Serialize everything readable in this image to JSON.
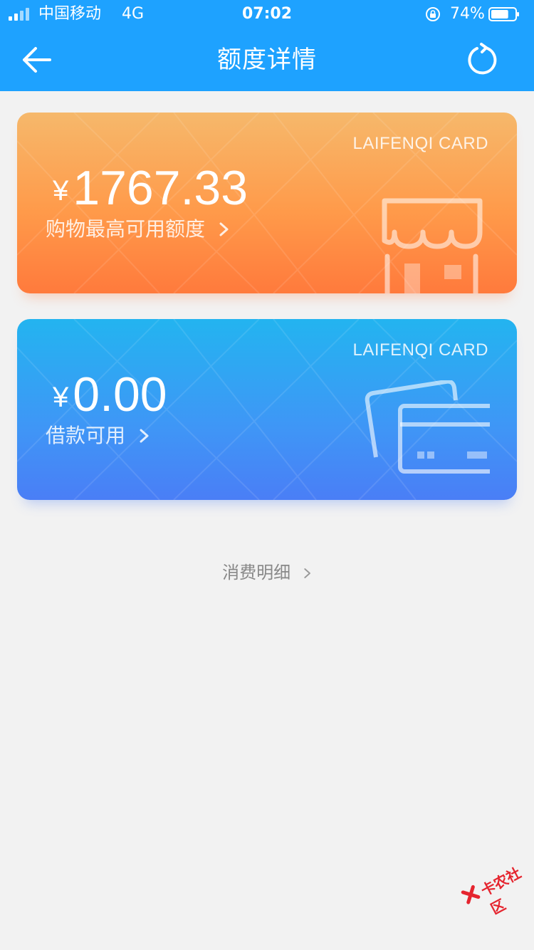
{
  "status": {
    "carrier": "中国移动",
    "network": "4G",
    "time": "07:02",
    "battery": "74%",
    "battery_level": 0.74
  },
  "nav": {
    "title": "额度详情",
    "back_icon": "arrow-left-icon",
    "refresh_icon": "refresh-icon"
  },
  "cards": [
    {
      "brand": "LAIFENQI CARD",
      "currency": "¥",
      "amount": "1767.33",
      "label": "购物最高可用额度",
      "icon": "shop-icon",
      "gradient": [
        "#f6b86b",
        "#ff7a3c"
      ]
    },
    {
      "brand": "LAIFENQI CARD",
      "currency": "¥",
      "amount": "0.00",
      "label": "借款可用",
      "icon": "wallet-icon",
      "gradient": [
        "#23b4f0",
        "#4a7ef6"
      ]
    }
  ],
  "detail_link": "消费明细",
  "watermark": "卡农社区",
  "colors": {
    "header": "#1ea2ff",
    "background": "#f2f2f2"
  }
}
